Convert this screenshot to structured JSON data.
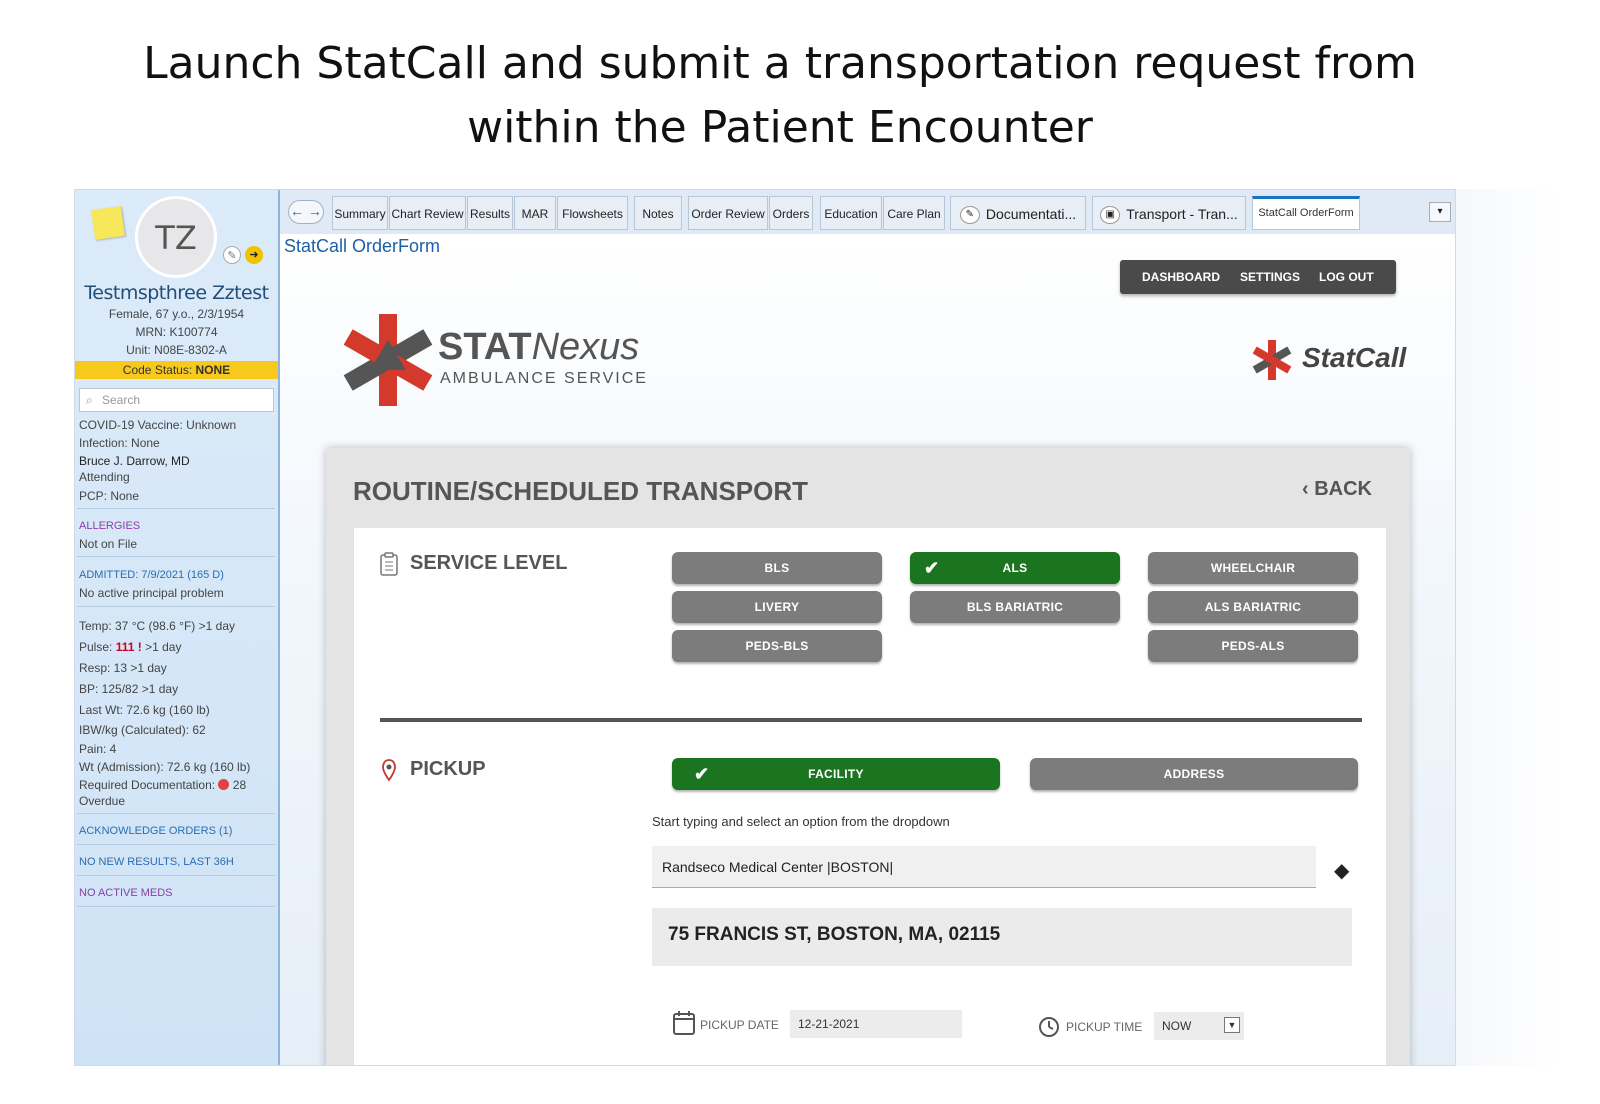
{
  "slide": {
    "title_line1": "Launch StatCall and submit a transportation request from",
    "title_line2": "within the Patient Encounter"
  },
  "patient": {
    "initials": "TZ",
    "name": "Testmspthree Zztest",
    "demographics": "Female, 67 y.o., 2/3/1954",
    "mrn": "MRN: K100774",
    "unit": "Unit: N08E-8302-A",
    "code_status_label": "Code Status:",
    "code_status_value": "NONE"
  },
  "sidebar": {
    "search_placeholder": "Search",
    "covid": "COVID-19 Vaccine: Unknown",
    "infection": "Infection: None",
    "attending_name": "Bruce J. Darrow, MD",
    "attending_role": "Attending",
    "pcp": "PCP: None",
    "allergies_header": "ALLERGIES",
    "allergies_value": "Not on File",
    "admitted": "ADMITTED: 7/9/2021 (165 D)",
    "principal_problem": "No active principal problem",
    "vitals": {
      "temp": "Temp:  37 °C (98.6 °F) >1 day",
      "pulse_label": "Pulse:",
      "pulse_value": "111",
      "pulse_suffix": ">1 day",
      "resp": "Resp:  13 >1 day",
      "bp": "BP:  125/82 >1 day",
      "last_wt": "Last Wt:  72.6 kg (160 lb)",
      "ibw": "IBW/kg (Calculated):  62",
      "pain": "Pain: 4",
      "wt_admission": "Wt (Admission): 72.6 kg (160 lb)",
      "req_doc_label": "Required Documentation:",
      "req_doc_count": "28",
      "overdue": "Overdue"
    },
    "ack_orders": "ACKNOWLEDGE ORDERS (1)",
    "no_new_results": "NO NEW RESULTS, LAST 36H",
    "no_active_meds": "NO ACTIVE MEDS"
  },
  "tabs": {
    "nav": "← →",
    "items": [
      "Summary",
      "Chart Review",
      "Results",
      "MAR",
      "Flowsheets",
      "Notes",
      "Order Review",
      "Orders",
      "Education",
      "Care Plan"
    ],
    "documentation": "Documentati...",
    "transport": "Transport - Tran...",
    "active": "StatCall OrderForm",
    "menu": "▾"
  },
  "content": {
    "activity_title": "StatCall OrderForm",
    "topnav": {
      "dashboard": "DASHBOARD",
      "settings": "SETTINGS",
      "logout": "LOG OUT"
    },
    "logo": {
      "stat": "STAT",
      "nexus": "Nexus",
      "sub": "AMBULANCE SERVICE",
      "statcall": "StatCall"
    }
  },
  "form": {
    "title": "ROUTINE/SCHEDULED TRANSPORT",
    "back": "‹ BACK",
    "service_level_label": "SERVICE LEVEL",
    "service_levels": {
      "bls": "BLS",
      "als": "ALS",
      "wheelchair": "WHEELCHAIR",
      "livery": "LIVERY",
      "bls_bariatric": "BLS BARIATRIC",
      "als_bariatric": "ALS BARIATRIC",
      "peds_bls": "PEDS-BLS",
      "peds_als": "PEDS-ALS"
    },
    "selected_service_level": "ALS",
    "pickup_label": "PICKUP",
    "pickup_options": {
      "facility": "FACILITY",
      "address": "ADDRESS"
    },
    "selected_pickup": "FACILITY",
    "hint": "Start typing and select an option from the dropdown",
    "facility_value": "Randseco Medical Center |BOSTON|",
    "address": "75 FRANCIS ST, BOSTON, MA, 02115",
    "pickup_date_label": "PICKUP DATE",
    "pickup_date_value": "12-21-2021",
    "pickup_time_label": "PICKUP TIME",
    "pickup_time_value": "NOW"
  },
  "colors": {
    "selected": "#1b7420",
    "unselected": "#7c7c7c",
    "brand_red": "#d33a2c",
    "code_status_bg": "#f7c91c"
  }
}
